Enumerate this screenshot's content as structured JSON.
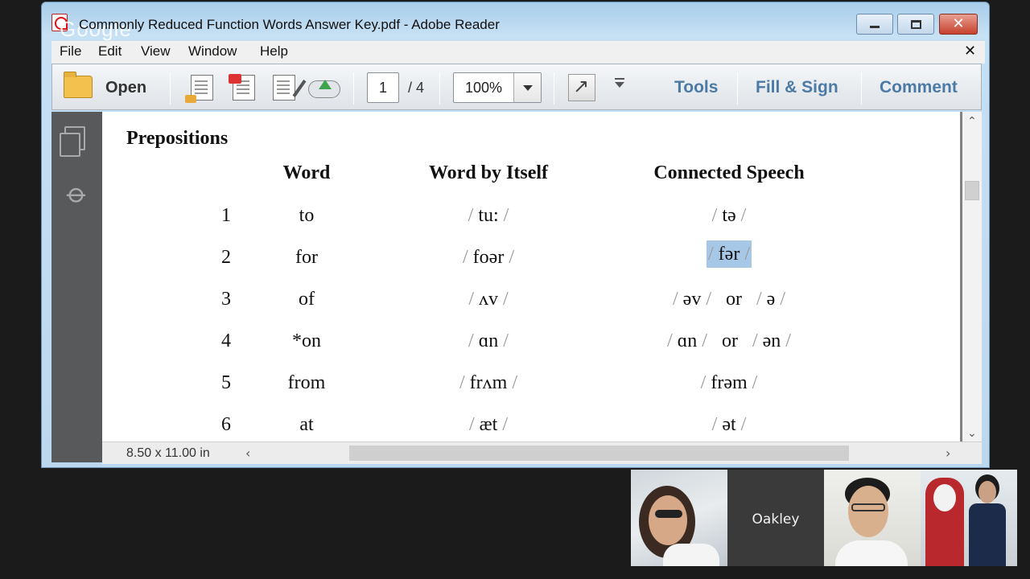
{
  "window": {
    "title": "Commonly Reduced Function Words Answer Key.pdf - Adobe Reader",
    "watermark": "Google"
  },
  "menu": [
    "File",
    "Edit",
    "View",
    "Window",
    "Help"
  ],
  "toolbar": {
    "open_label": "Open",
    "page_current": "1",
    "page_total": "/ 4",
    "zoom": "100%",
    "tools_label": "Tools",
    "fill_sign_label": "Fill & Sign",
    "comment_label": "Comment"
  },
  "document": {
    "heading": "Prepositions",
    "columns": [
      "Word",
      "Word by Itself",
      "Connected Speech"
    ],
    "rows": [
      {
        "num": "1",
        "word": "to",
        "itself": "tu:",
        "connected": "tə"
      },
      {
        "num": "2",
        "word": "for",
        "itself": "foər",
        "connected": "fər"
      },
      {
        "num": "3",
        "word": "of",
        "itself": "ʌv",
        "connected_a": "əv",
        "or": "or",
        "connected_b": "ə"
      },
      {
        "num": "4",
        "word": "*on",
        "itself": "ɑn",
        "connected_a": "ɑn",
        "or": "or",
        "connected_b": "ən"
      },
      {
        "num": "5",
        "word": "from",
        "itself": "frʌm",
        "connected": "frəm"
      },
      {
        "num": "6",
        "word": "at",
        "itself": "æt",
        "connected": "ət"
      }
    ]
  },
  "status": {
    "page_size": "8.50 x 11.00 in"
  },
  "participants": {
    "tile2_name": "Oakley"
  },
  "colors": {
    "accent_link": "#4c7aa6",
    "selection": "#a6c8e6"
  }
}
